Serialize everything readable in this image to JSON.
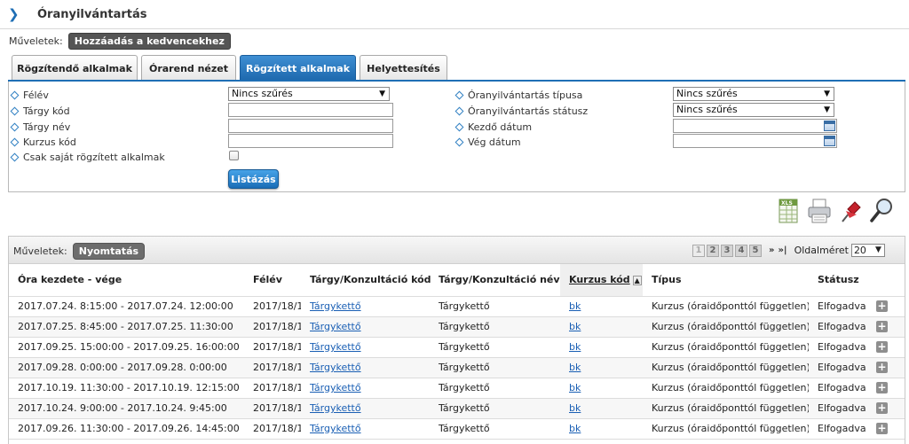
{
  "header": {
    "title": "Óranyilvántartás"
  },
  "top_operations": {
    "label": "Műveletek:",
    "favorite_button": "Hozzáadás a kedvencekhez"
  },
  "tabs": [
    {
      "label": "Rögzítendő alkalmak",
      "active": false
    },
    {
      "label": "Órarend nézet",
      "active": false
    },
    {
      "label": "Rögzített alkalmak",
      "active": true
    },
    {
      "label": "Helyettesítés",
      "active": false
    }
  ],
  "filters": {
    "felev": {
      "label": "Félév",
      "value": "Nincs szűrés"
    },
    "targy_kod": {
      "label": "Tárgy kód",
      "value": ""
    },
    "targy_nev": {
      "label": "Tárgy név",
      "value": ""
    },
    "kurzus_kod": {
      "label": "Kurzus kód",
      "value": ""
    },
    "csak_sajat": {
      "label": "Csak saját rögzített alkalmak",
      "checked": false
    },
    "tipus": {
      "label": "Óranyilvántartás típusa",
      "value": "Nincs szűrés"
    },
    "statusz": {
      "label": "Óranyilvántartás státusz",
      "value": "Nincs szűrés"
    },
    "kezdo_datum": {
      "label": "Kezdő dátum",
      "value": ""
    },
    "veg_datum": {
      "label": "Vég dátum",
      "value": ""
    },
    "list_button": "Listázás"
  },
  "toolbar_icons": [
    "xls-export-icon",
    "print-icon",
    "pin-icon",
    "magnifier-icon"
  ],
  "grid": {
    "operations_label": "Műveletek:",
    "print_button": "Nyomtatás",
    "pager": {
      "pages": [
        "1",
        "2",
        "3",
        "4",
        "5"
      ],
      "current": "1",
      "next": "»",
      "last": "»|",
      "page_size_label": "Oldalméret",
      "page_size": "20"
    },
    "columns": [
      "Óra kezdete - vége",
      "Félév",
      "Tárgy/Konzultáció kód",
      "Tárgy/Konzultáció név",
      "Kurzus kód",
      "Típus",
      "Státusz"
    ],
    "sorted_column": "Kurzus kód",
    "rows": [
      {
        "time": "2017.07.24. 8:15:00 - 2017.07.24. 12:00:00",
        "felev": "2017/18/1",
        "kod": "Tárgykettő",
        "nev": "Tárgykettő",
        "kurzus": "bk",
        "tipus": "Kurzus (óraidőponttól független)",
        "statusz": "Elfogadva"
      },
      {
        "time": "2017.07.25. 8:45:00 - 2017.07.25. 11:30:00",
        "felev": "2017/18/1",
        "kod": "Tárgykettő",
        "nev": "Tárgykettő",
        "kurzus": "bk",
        "tipus": "Kurzus (óraidőponttól független)",
        "statusz": "Elfogadva"
      },
      {
        "time": "2017.09.25. 15:00:00 - 2017.09.25. 16:00:00",
        "felev": "2017/18/1",
        "kod": "Tárgykettő",
        "nev": "Tárgykettő",
        "kurzus": "bk",
        "tipus": "Kurzus (óraidőponttól független)",
        "statusz": "Elfogadva"
      },
      {
        "time": "2017.09.28. 0:00:00 - 2017.09.28. 0:00:00",
        "felev": "2017/18/1",
        "kod": "Tárgykettő",
        "nev": "Tárgykettő",
        "kurzus": "bk",
        "tipus": "Kurzus (óraidőponttól független)",
        "statusz": "Elfogadva"
      },
      {
        "time": "2017.10.19. 11:30:00 - 2017.10.19. 12:15:00",
        "felev": "2017/18/1",
        "kod": "Tárgykettő",
        "nev": "Tárgykettő",
        "kurzus": "bk",
        "tipus": "Kurzus (óraidőponttól független)",
        "statusz": "Elfogadva"
      },
      {
        "time": "2017.10.24. 9:00:00 - 2017.10.24. 9:45:00",
        "felev": "2017/18/1",
        "kod": "Tárgykettő",
        "nev": "Tárgykettő",
        "kurzus": "bk",
        "tipus": "Kurzus (óraidőponttól független)",
        "statusz": "Elfogadva"
      },
      {
        "time": "2017.09.26. 11:30:00 - 2017.09.26. 14:45:00",
        "felev": "2017/18/1",
        "kod": "Tárgykettő",
        "nev": "Tárgykettő",
        "kurzus": "bk",
        "tipus": "Kurzus (óraidőponttól független)",
        "statusz": "Elfogadva"
      }
    ],
    "row_action": "+"
  }
}
